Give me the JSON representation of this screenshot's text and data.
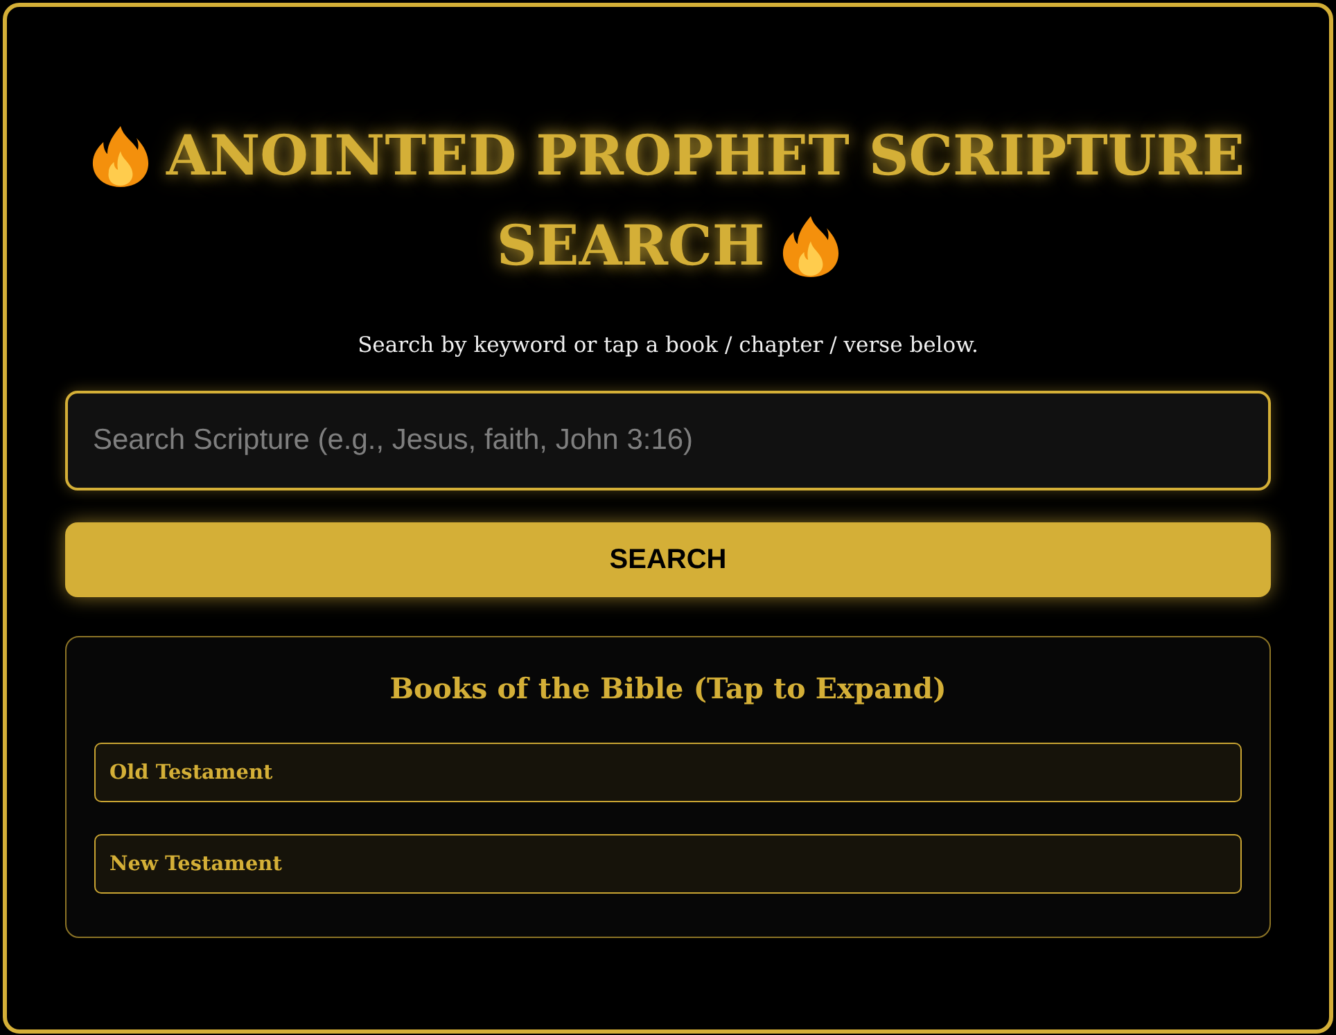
{
  "header": {
    "title_lines": [
      "ANOINTED PROPHET SCRIPTURE",
      "SEARCH"
    ],
    "subtitle": "Search by keyword or tap a book / chapter / verse below."
  },
  "search": {
    "placeholder": "Search Scripture (e.g., Jesus, faith, John 3:16)",
    "button": "SEARCH"
  },
  "books_panel": {
    "title": "Books of the Bible (Tap to Expand)",
    "sections": [
      {
        "label": "Old Testament"
      },
      {
        "label": "New Testament"
      }
    ]
  }
}
